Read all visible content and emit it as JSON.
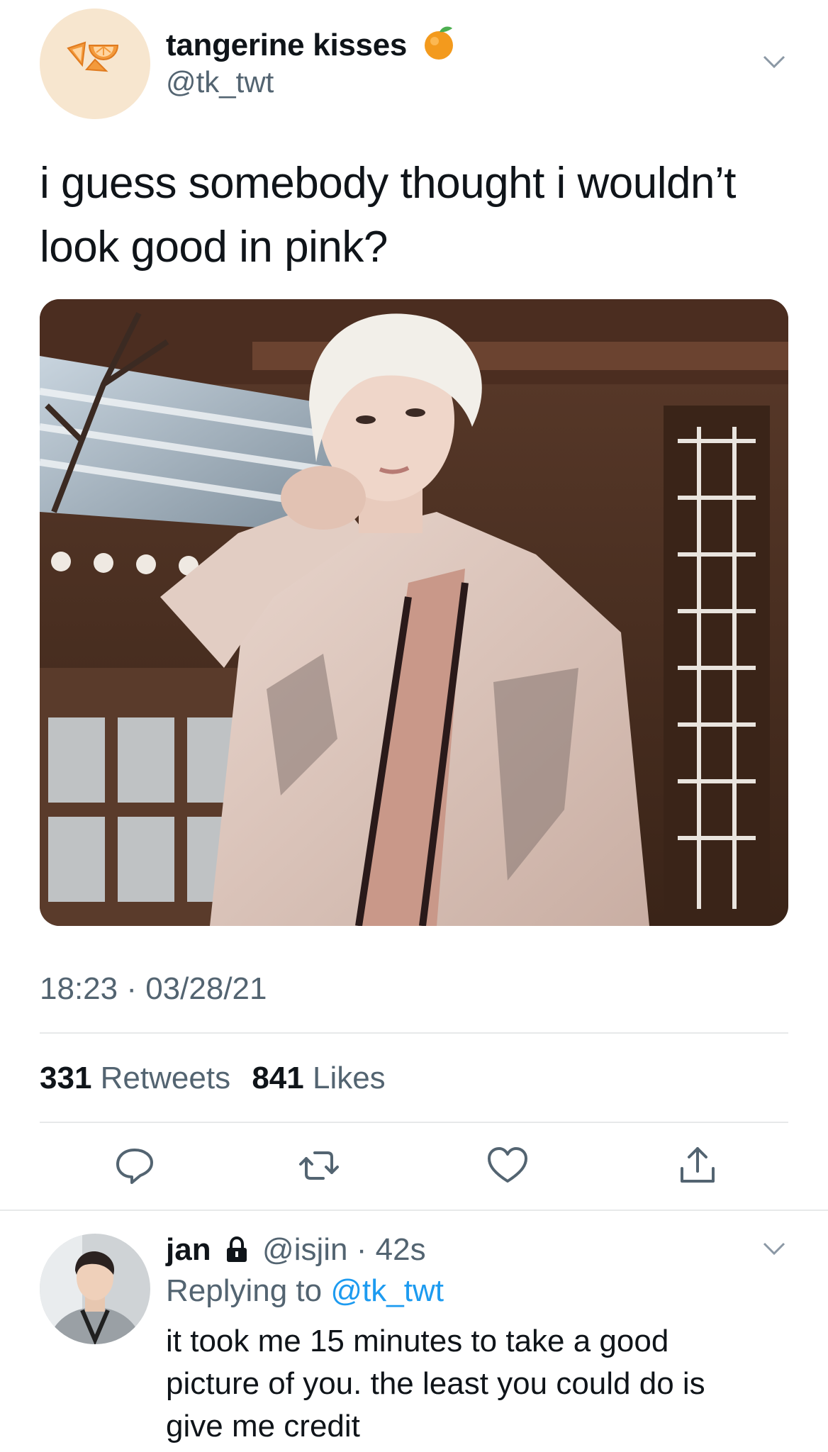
{
  "tweet": {
    "display_name": "tangerine kisses",
    "name_emoji": "tangerine-emoji",
    "handle": "@tk_twt",
    "avatar_caption": "tangerine kisses",
    "text_line1": "i guess somebody thought i wouldn’t",
    "text_line2": "look good in pink?",
    "photo_description": "",
    "timestamp": "18:23 · 03/28/21",
    "retweets_count": "331",
    "retweets_label": "Retweets",
    "likes_count": "841",
    "likes_label": "Likes"
  },
  "actions": {
    "reply_icon": "speech-bubble-icon",
    "retweet_icon": "retweet-icon",
    "like_icon": "heart-icon",
    "share_icon": "share-icon"
  },
  "reply": {
    "display_name": "jan",
    "lock_icon": "lock-icon",
    "handle": "@isjin",
    "time": "· 42s",
    "replying_prefix": "Replying to",
    "replying_to": "@tk_twt",
    "text_line1": "it took me 15 minutes to take a good",
    "text_line2": "picture of you. the least you could do is",
    "text_line3": "give me credit"
  },
  "colors": {
    "accent": "#1d9bf0",
    "secondary_text": "#536471",
    "divider": "#e7e9ea"
  }
}
